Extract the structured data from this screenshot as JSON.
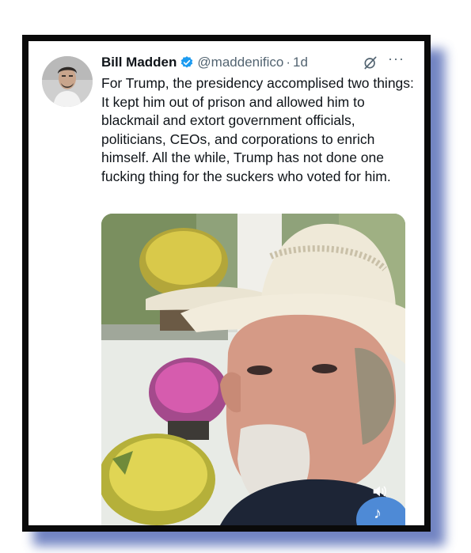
{
  "tweet": {
    "author_name": "Bill Madden",
    "handle": "@maddenifico",
    "separator": "·",
    "time": "1d",
    "text": "For Trump, the presidency accomplised two things: It kept him out of prison and allowed him to blackmail and extort government officials, politicians, CEOs, and corporations to enrich himself. All the while, Trump has not done one fucking thing for the suckers who voted for him.",
    "more_label": "···"
  },
  "icons": {
    "verified": "verified-badge-icon",
    "grok": "grok-icon",
    "sound": "sound-icon",
    "tiktok": "tiktok-icon"
  },
  "colors": {
    "verified": "#1d9bf0",
    "frame": "#0a0a0a",
    "shadow": "#5a6fb8",
    "secondary_text": "#536471"
  }
}
